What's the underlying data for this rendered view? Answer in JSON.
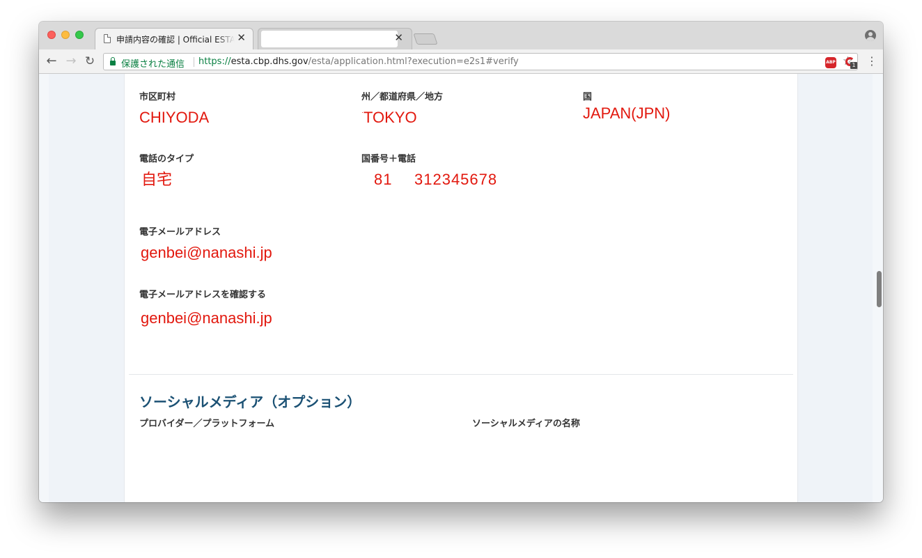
{
  "browser": {
    "tabs": [
      {
        "title": "申請内容の確認 | Official ESTA Application Website",
        "close": "✕"
      },
      {
        "title": "",
        "close": "✕"
      }
    ],
    "nav": {
      "back": "←",
      "forward": "→",
      "reload": "↻"
    },
    "address_bar": {
      "secure_label": "保護された通信",
      "scheme": "https://",
      "host": "esta.cbp.dhs.gov",
      "path": "/esta/application.html?execution=e2s1#verify"
    },
    "star": "☆",
    "extensions": {
      "abp": "ABP",
      "badge": "1"
    },
    "menu": "⋮"
  },
  "form": {
    "city": {
      "label": "市区町村",
      "value": "CHIYODA"
    },
    "state": {
      "label": "州／都道府県／地方",
      "value": "TOKYO",
      "prefix_mark": "·"
    },
    "country": {
      "label": "国",
      "value": "JAPAN(JPN)"
    },
    "phone_type": {
      "label": "電話のタイプ",
      "value": "自宅"
    },
    "phone": {
      "label": "国番号＋電話",
      "country_code": "81",
      "number": "312345678"
    },
    "email": {
      "label": "電子メールアドレス",
      "value": "genbei@nanashi.jp"
    },
    "email_confirm": {
      "label": "電子メールアドレスを確認する",
      "value": "genbei@nanashi.jp"
    }
  },
  "social_media": {
    "title": "ソーシャルメディア（オプション）",
    "provider_label": "プロバイダー／プラットフォーム",
    "name_label": "ソーシャルメディアの名称"
  },
  "colors": {
    "value_red": "#e2180e",
    "section_title": "#1b5174",
    "secure_green": "#0b8043"
  }
}
